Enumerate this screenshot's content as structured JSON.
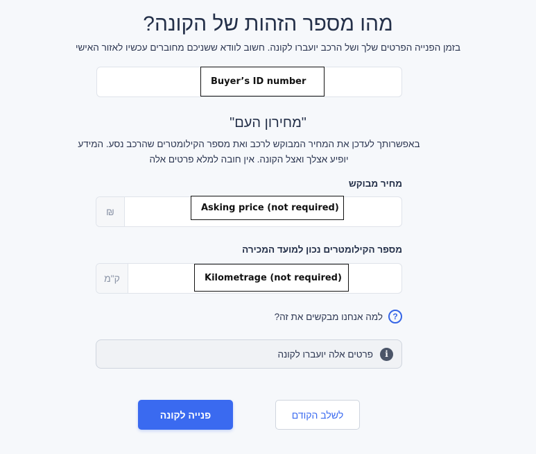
{
  "header": {
    "title": "מהו מספר הזהות של הקונה?",
    "subtitle": "בזמן הפנייה הפרטים שלך ושל הרכב יועברו לקונה. חשוב לוודא ששניכם מחוברים עכשיו לאזור האישי"
  },
  "buyer_id": {
    "annotation": "Buyer’s ID number",
    "value": ""
  },
  "price_section": {
    "title": "\"מחירון העם\"",
    "description": "באפשרותך לעדכן את המחיר המבוקש לרכב ואת מספר הקילומטרים שהרכב נסע. המידע יופיע אצלך ואצל הקונה. אין חובה למלא פרטים אלה"
  },
  "asking_price": {
    "label": "מחיר מבוקש",
    "currency_symbol": "₪",
    "annotation": "Asking price (not required)",
    "value": ""
  },
  "kilometrage": {
    "label": "מספר הקילומטרים נכון למועד המכירה",
    "unit": "ק\"מ",
    "annotation": "Kilometrage (not required)",
    "value": ""
  },
  "why_link": {
    "icon": "question-circle-icon",
    "text": "למה אנחנו מבקשים את זה?"
  },
  "info": {
    "icon": "info-icon",
    "text": "פרטים אלה יועברו לקונה"
  },
  "buttons": {
    "submit_label": "פנייה לקונה",
    "back_label": "לשלב הקודם"
  },
  "colors": {
    "primary": "#3a6af0",
    "background": "#f6f8fb"
  }
}
